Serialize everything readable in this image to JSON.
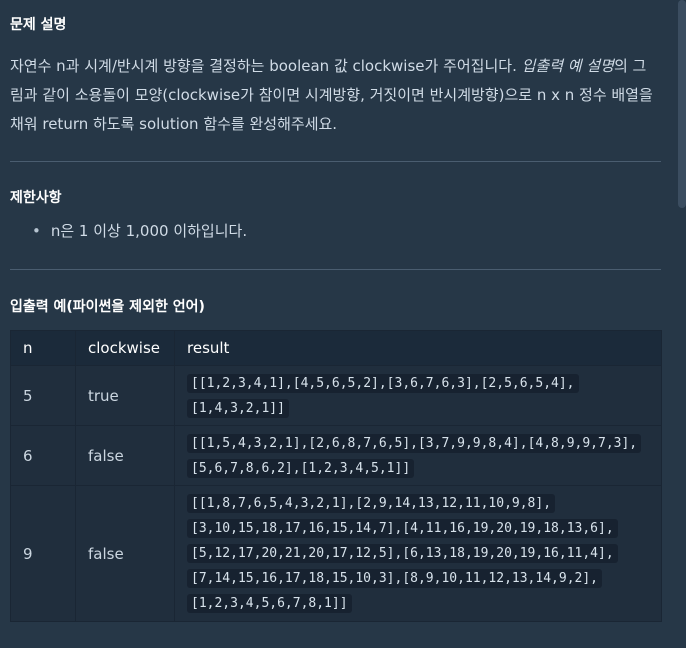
{
  "sections": {
    "problem_title": "문제 설명",
    "desc_part1": "자연수 n과 시계/반시계 방향을 결정하는 boolean 값 clockwise가 주어집니다. ",
    "desc_emph": "입출력 예 설명",
    "desc_part2": "의 그림과 같이 소용돌이 모양(clockwise가 참이면 시계방향, 거짓이면 반시계방향)으로 n x n 정수 배열을 채워 return 하도록 solution 함수를 완성해주세요.",
    "limits_title": "제한사항",
    "limits": [
      "n은 1 이상 1,000 이하입니다."
    ],
    "examples_title": "입출력 예(파이썬을 제외한 언어)"
  },
  "table": {
    "headers": [
      "n",
      "clockwise",
      "result"
    ],
    "rows": [
      {
        "n": "5",
        "clockwise": "true",
        "result": "[[1,2,3,4,1],[4,5,6,5,2],[3,6,7,6,3],[2,5,6,5,4],[1,4,3,2,1]]"
      },
      {
        "n": "6",
        "clockwise": "false",
        "result": "[[1,5,4,3,2,1],[2,6,8,7,6,5],[3,7,9,9,8,4],[4,8,9,9,7,3],[5,6,7,8,6,2],[1,2,3,4,5,1]]"
      },
      {
        "n": "9",
        "clockwise": "false",
        "result": "[[1,8,7,6,5,4,3,2,1],[2,9,14,13,12,11,10,9,8],[3,10,15,18,17,16,15,14,7],[4,11,16,19,20,19,18,13,6],[5,12,17,20,21,20,17,12,5],[6,13,18,19,20,19,16,11,4],[7,14,15,16,17,18,15,10,3],[8,9,10,11,12,13,14,9,2],[1,2,3,4,5,6,7,8,1]]"
      }
    ]
  }
}
